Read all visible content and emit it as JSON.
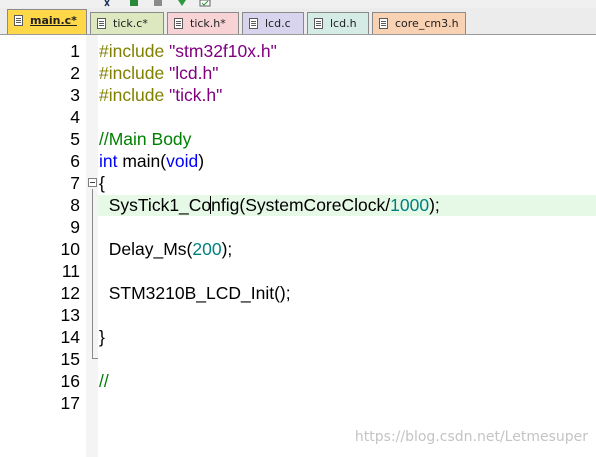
{
  "toolbar": {
    "icons": [
      "toolbar-icon",
      "build-icon",
      "load-icon",
      "debug-icon",
      "check-icon"
    ]
  },
  "tabs": [
    {
      "label": "main.c*",
      "active": true
    },
    {
      "label": "tick.c*",
      "active": false
    },
    {
      "label": "tick.h*",
      "active": false
    },
    {
      "label": "lcd.c",
      "active": false
    },
    {
      "label": "lcd.h",
      "active": false
    },
    {
      "label": "core_cm3.h",
      "active": false
    }
  ],
  "editor": {
    "line_numbers": [
      "1",
      "2",
      "3",
      "4",
      "5",
      "6",
      "7",
      "8",
      "9",
      "10",
      "11",
      "12",
      "13",
      "14",
      "15",
      "16",
      "17"
    ],
    "current_line": 8,
    "lines": {
      "l1": {
        "directive": "#include ",
        "str": "\"stm32f10x.h\""
      },
      "l2": {
        "directive": "#include ",
        "str": "\"lcd.h\""
      },
      "l3": {
        "directive": "#include ",
        "str": "\"tick.h\""
      },
      "l5": {
        "comment": "//Main Body"
      },
      "l6": {
        "kw1": "int",
        "mid": " main(",
        "kw2": "void",
        "end": ")"
      },
      "l7": {
        "text": "{"
      },
      "l8": {
        "before_caret": "  SysTick1_Co",
        "after_caret": "nfig(SystemCoreClock/",
        "num": "1000",
        "end": ");"
      },
      "l10": {
        "text": "  Delay_Ms(",
        "num": "200",
        "end": ");"
      },
      "l12": {
        "text": "  STM3210B_LCD_Init();"
      },
      "l14": {
        "text": "}"
      },
      "l16": {
        "comment": "//"
      }
    }
  },
  "watermark": "https://blog.csdn.net/Letmesuper"
}
